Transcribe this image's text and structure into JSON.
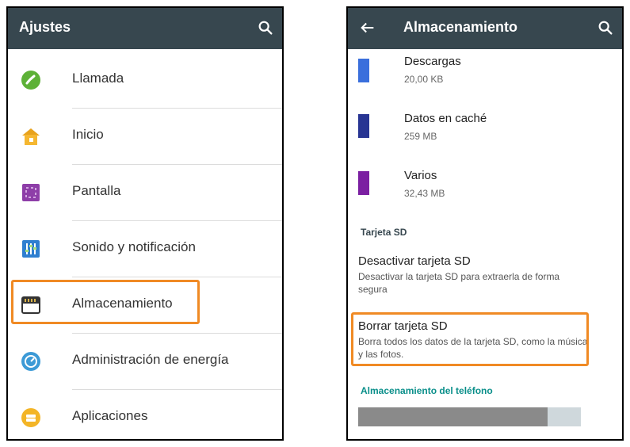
{
  "left": {
    "title": "Ajustes",
    "items": [
      {
        "label": "Llamada",
        "icon": "phone-icon"
      },
      {
        "label": "Inicio",
        "icon": "home-icon"
      },
      {
        "label": "Pantalla",
        "icon": "display-icon"
      },
      {
        "label": "Sonido y notificación",
        "icon": "sound-icon"
      },
      {
        "label": "Almacenamiento",
        "icon": "sd-card-icon",
        "highlighted": true
      },
      {
        "label": "Administración de energía",
        "icon": "battery-icon"
      },
      {
        "label": "Aplicaciones",
        "icon": "apps-icon"
      }
    ]
  },
  "right": {
    "title": "Almacenamiento",
    "storage_items": [
      {
        "name": "Descargas",
        "size": "20,00 KB",
        "color": "#3a6fdc"
      },
      {
        "name": "Datos en caché",
        "size": "259 MB",
        "color": "#283593"
      },
      {
        "name": "Varios",
        "size": "32,43 MB",
        "color": "#7b1fa2"
      }
    ],
    "sd_section_header": "Tarjeta SD",
    "unmount_title": "Desactivar tarjeta SD",
    "unmount_desc": "Desactivar la tarjeta SD para extraerla de forma segura",
    "erase_title": "Borrar tarjeta SD",
    "erase_desc": "Borra todos los datos de la tarjeta SD, como la música y las fotos.",
    "phone_storage_header": "Almacenamiento del teléfono",
    "phone_storage_used_fraction": 0.85
  },
  "colors": {
    "appbar": "#37474f",
    "highlight": "#f08a24",
    "teal": "#0a8f8a"
  }
}
